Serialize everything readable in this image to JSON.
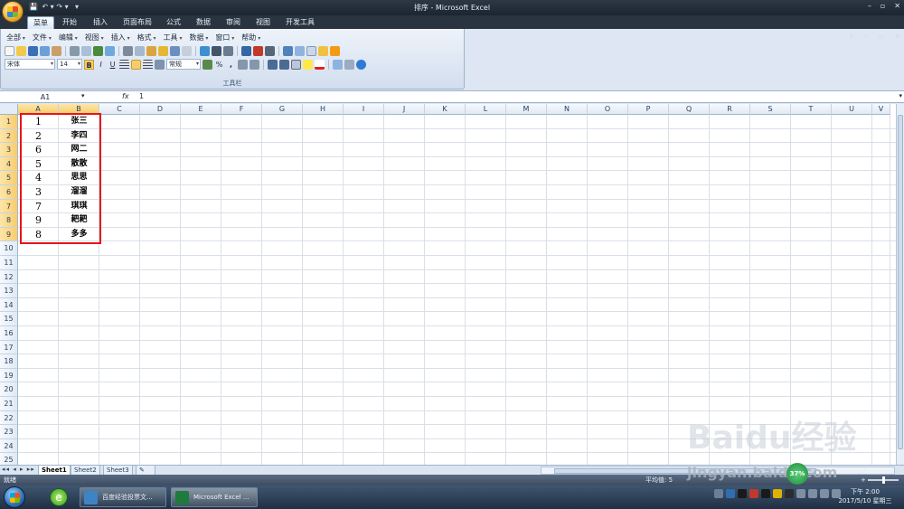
{
  "window": {
    "title": "排序 - Microsoft Excel",
    "controls": [
      "–",
      "▫",
      "✕"
    ],
    "mdi_controls": [
      "?",
      "–",
      "▫",
      "✕"
    ]
  },
  "quick_access": [
    "💾",
    "↶ ▾",
    "↷ ▾",
    "▾"
  ],
  "ribbon_tabs": [
    "菜单",
    "开始",
    "插入",
    "页面布局",
    "公式",
    "数据",
    "审阅",
    "视图",
    "开发工具"
  ],
  "ribbon": {
    "menus": [
      "全部",
      "文件",
      "编辑",
      "视图",
      "插入",
      "格式",
      "工具",
      "数据",
      "窗口",
      "帮助"
    ],
    "font_name": "宋体",
    "font_size": "14",
    "number_format": "常规",
    "format_buttons": [
      "B",
      "I",
      "U"
    ],
    "percent": "%",
    "comma": ",",
    "group_label": "工具栏"
  },
  "formula_bar": {
    "name_box": "A1",
    "fx": "fx",
    "value": "1"
  },
  "grid": {
    "columns": [
      "A",
      "B",
      "C",
      "D",
      "E",
      "F",
      "G",
      "H",
      "I",
      "J",
      "K",
      "L",
      "M",
      "N",
      "O",
      "P",
      "Q",
      "R",
      "S",
      "T",
      "U",
      "V"
    ],
    "rows": [
      "1",
      "2",
      "3",
      "4",
      "5",
      "6",
      "7",
      "8",
      "9",
      "10",
      "11",
      "12",
      "13",
      "14",
      "15",
      "16",
      "17",
      "18",
      "19",
      "20",
      "21",
      "22",
      "23",
      "24",
      "25"
    ],
    "data": [
      [
        "1",
        "张三"
      ],
      [
        "2",
        "李四"
      ],
      [
        "6",
        "网二"
      ],
      [
        "5",
        "散散"
      ],
      [
        "4",
        "思思"
      ],
      [
        "3",
        "溜溜"
      ],
      [
        "7",
        "琪琪"
      ],
      [
        "9",
        "耙耙"
      ],
      [
        "8",
        "多多"
      ]
    ]
  },
  "sheets": [
    "Sheet1",
    "Sheet2",
    "Sheet3"
  ],
  "sheet_nav": "◂◂ ◂ ▸ ▸▸",
  "status": {
    "ready": "就绪",
    "average": "平均值: 5",
    "zoom_symbol": "+"
  },
  "taskbar": {
    "items": [
      "百度经验投票文...",
      "Microsoft Excel ..."
    ],
    "clock_time": "下午 2:00",
    "clock_date": "2017/5/10 星期三",
    "badge": "37%"
  },
  "watermark": {
    "main": "Baidu经验",
    "sub": "jingyan.baidu.com"
  }
}
